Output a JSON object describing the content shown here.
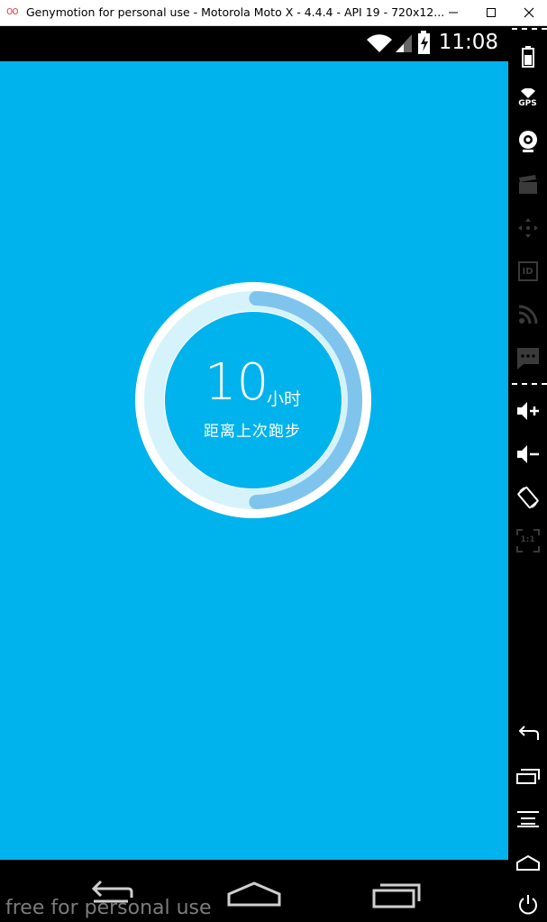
{
  "window": {
    "logo": "oo",
    "title": "Genymotion for personal use - Motorola Moto X - 4.4.4 - API 19 - 720x12..."
  },
  "statusbar": {
    "time": "11:08"
  },
  "main": {
    "hours_value": "10",
    "hours_unit": "小时",
    "caption": "距离上次跑步",
    "ring_progress": 0.5
  },
  "watermark": "free for personal use",
  "sidebar": {
    "gps_label": "GPS",
    "id_label": "ID",
    "ratio_label": "1:1"
  },
  "colors": {
    "screen_bg": "#00b3ec",
    "ring_track": "#d6f3fb",
    "ring_progress": "#7fc4ec"
  }
}
